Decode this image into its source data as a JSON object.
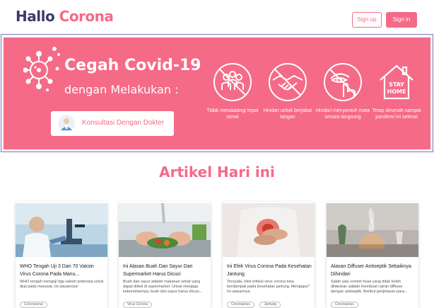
{
  "header": {
    "logo_part1": "Hallo",
    "logo_part2": "Corona",
    "signup_label": "Sign up",
    "signin_label": "Sign in"
  },
  "banner": {
    "title": "Cegah Covid-19",
    "subtitle": "dengan Melakukan :",
    "consult_label": "Konsultasi Dengan Dokter",
    "tips": [
      {
        "label": "Tidak mendatangi tepat ramai",
        "icon": "crowd-icon"
      },
      {
        "label": "Hindari untuk berjabat tangan",
        "icon": "handshake-icon"
      },
      {
        "label": "Hindari menyentuh mata secara langsung",
        "icon": "eye-touch-icon"
      },
      {
        "label": "Tetap dirumah sampai pandemi ini selesai",
        "icon": "stay-home-icon",
        "icon_text_1": "STAY",
        "icon_text_2": "HOME"
      }
    ]
  },
  "articles_section": {
    "title": "Artikel Hari ini"
  },
  "articles": [
    {
      "title": "WHO Tengah Uji 3 Dari 70 Vaksin Virus Corona Pada Manu...",
      "excerpt": "WHO tengah menguji tiga vaksin potensial untuk diuji pada manusia. Ini ulasannya!",
      "tags": [
        "Coronavirus"
      ]
    },
    {
      "title": "Ini Alasan Buah Dan Sayur Dari Supermarket Harus Dicuci",
      "excerpt": "Buah dan sayur adalah makanan sehat yang dapat dibeli di supermarket. Untuk menjaga kebersihannya, buah dan sayur harus dicuci...",
      "tags": [
        "Virus Corona"
      ]
    },
    {
      "title": "Ini Efek Virus Corona Pada Kesehatan Jantung",
      "excerpt": "Ternyata, efek infeksi virus corona bisa berdampak pada kesehatan jantung. Mengapa? Ini ulasannya.",
      "tags": [
        "Coronavirus",
        "Jantung"
      ]
    },
    {
      "title": "Alasan Diffuser Antiseptik Sebaiknya Dihindari",
      "excerpt": "Salah satu contoh hoax yang tidak boleh dilakukan adalah membuat cairan diffuser dengan antiseptik. Berikut penjelasan para...",
      "tags": [
        "Coronavirus"
      ]
    }
  ],
  "colors": {
    "accent": "#f56a87",
    "logo_dark": "#3d3a6b"
  }
}
